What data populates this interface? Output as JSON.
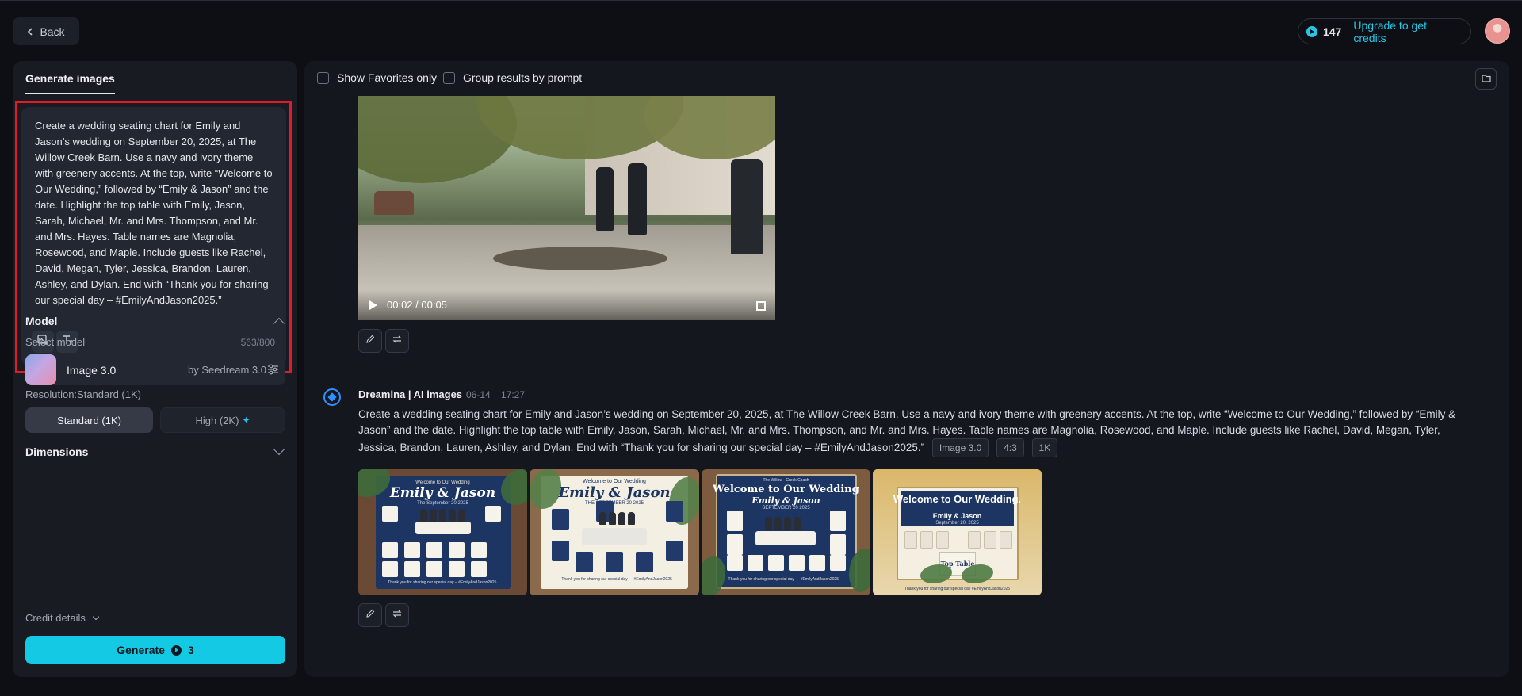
{
  "topbar": {
    "back_label": "Back",
    "credits": "147",
    "upgrade_label": "Upgrade to get credits"
  },
  "sidebar": {
    "tab_label": "Generate images",
    "prompt_text": "Create a wedding seating chart for Emily and Jason’s wedding on September 20, 2025, at The Willow Creek Barn. Use a navy and ivory theme with greenery accents. At the top, write “Welcome to Our Wedding,” followed by “Emily & Jason” and the date. Highlight the top table with Emily, Jason, Sarah, Michael, Mr. and Mrs. Thompson, and Mr. and Mrs. Hayes. Table names are Magnolia, Rosewood, and Maple. Include guests like Rachel, David, Megan, Tyler, Jessica, Brandon, Lauren, Ashley, and Dylan. End with “Thank you for sharing our special day – #EmilyAndJason2025.”",
    "char_count": "563/800",
    "model_section": "Model",
    "select_model_label": "Select model",
    "model_name": "Image 3.0",
    "model_by": "by Seedream 3.0",
    "resolution_label": "Resolution:Standard (1K)",
    "res_standard": "Standard (1K)",
    "res_high": "High (2K)",
    "dimensions_section": "Dimensions",
    "credit_details": "Credit details",
    "generate_label": "Generate",
    "generate_cost": "3"
  },
  "main": {
    "show_favorites": "Show Favorites only",
    "group_results": "Group results by prompt",
    "video_time": "00:02 / 00:05",
    "generation": {
      "source": "Dreamina | AI images",
      "date": "06-14",
      "time": "17:27",
      "prompt": "Create a wedding seating chart for Emily and Jason’s wedding on September 20, 2025, at The Willow Creek Barn. Use a navy and ivory theme with greenery accents. At the top, write “Welcome to Our Wedding,” followed by “Emily & Jason” and the date. Highlight the top table with Emily, Jason, Sarah, Michael, Mr. and Mrs. Thompson, and Mr. and Mrs. Hayes. Table names are Magnolia, Rosewood, and Maple. Include guests like Rachel, David, Megan, Tyler, Jessica, Brandon, Lauren, Ashley, and Dylan. End with “Thank you for sharing our special day – #EmilyAndJason2025.”",
      "tags": [
        "Image 3.0",
        "4:3",
        "1K"
      ]
    },
    "images": [
      {
        "welcome": "Welcome to Our Wedding",
        "names": "Emily & Jason",
        "date": "The September 20 2025",
        "footer": "Thank you for sharing our special day – #EmilyAndJason2025."
      },
      {
        "welcome": "Welcome to Our Wedding",
        "names": "Emily & Jason",
        "date": "THE SEPTEMBER 20 2025",
        "footer": "— Thank you for sharing our special day — #EmilyAndJason2025"
      },
      {
        "top": "The Willow · Creek Coach",
        "welcome": "Welcome to Our Wedding",
        "names": "Emily & Jason",
        "date": "SEPTEMBER 20 2025",
        "footer": "Thank you for sharing our special day — #EmilyAndJason2025 —"
      },
      {
        "welcome": "Welcome to Our Wedding.",
        "names": "Emily & Jason",
        "date": "September 20, 2025",
        "top_table": "Top Table",
        "footer": "Thank you for sharing our special day #EmilyAndJason2025"
      }
    ]
  },
  "colors": {
    "accent": "#13c9e3",
    "highlight_border": "#e21b2a",
    "navy": "#1c3563"
  }
}
